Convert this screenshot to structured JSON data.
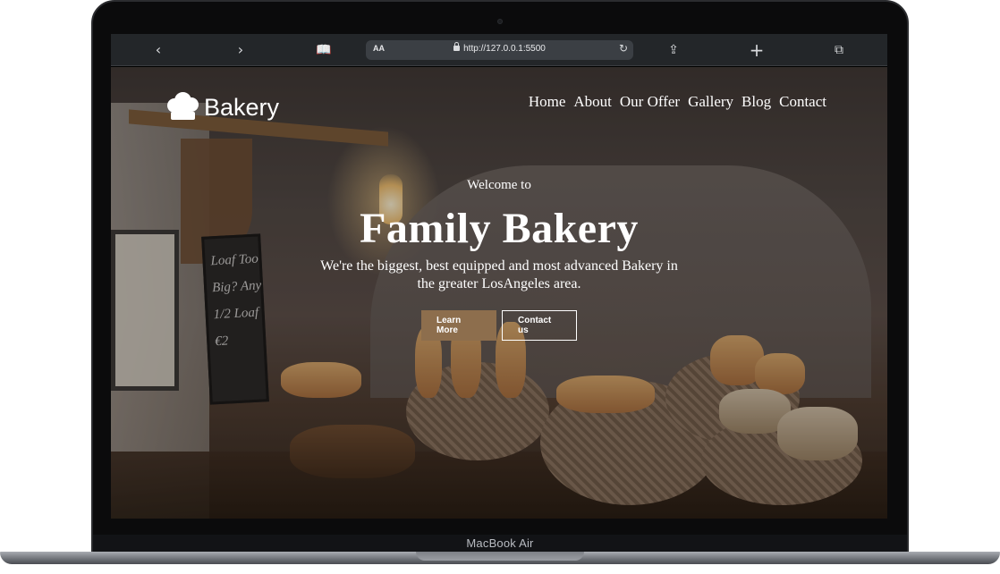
{
  "device": {
    "label": "MacBook Air"
  },
  "browser": {
    "url": "http://127.0.0.1:5500",
    "aa_label": "AA",
    "icons": [
      "back-icon",
      "forward-icon",
      "book-icon",
      "reload-icon",
      "share-icon",
      "new-tab-icon",
      "tabs-icon"
    ]
  },
  "site": {
    "logo_text": "Bakery",
    "nav": [
      "Home",
      "About",
      "Our Offer",
      "Gallery",
      "Blog",
      "Contact"
    ],
    "hero": {
      "welcome": "Welcome to",
      "title": "Family Bakery",
      "subtitle_line1": "We're the biggest, best equipped and most advanced Bakery in",
      "subtitle_line2": "the greater LosAngeles area.",
      "learn_more": "Learn More",
      "contact_us": "Contact us"
    },
    "chalkboard": "Loaf Too Big? Any 1/2 Loaf €2",
    "colors": {
      "accent": "#8d6e4d",
      "toolbar": "#232629"
    }
  }
}
